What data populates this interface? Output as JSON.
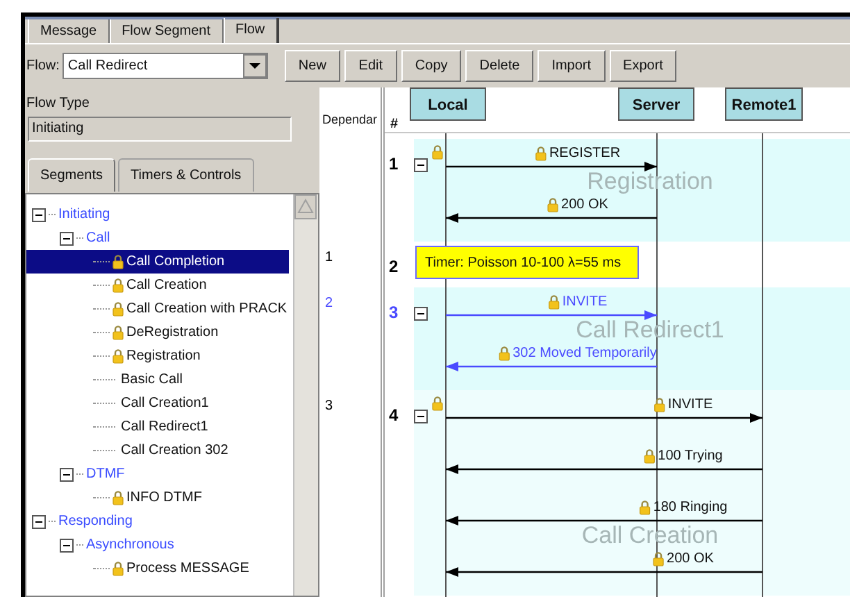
{
  "tabs": [
    {
      "label": "Message",
      "selected": false
    },
    {
      "label": "Flow Segment",
      "selected": false
    },
    {
      "label": "Flow",
      "selected": true
    }
  ],
  "flow": {
    "label": "Flow:",
    "value": "Call Redirect"
  },
  "toolbar": [
    "New",
    "Edit",
    "Copy",
    "Delete",
    "Import",
    "Export"
  ],
  "flow_type": {
    "label": "Flow Type",
    "value": "Initiating"
  },
  "panel_tabs": [
    {
      "label": "Segments",
      "selected": true
    },
    {
      "label": "Timers & Controls",
      "selected": false
    }
  ],
  "tree": [
    {
      "label": "Initiating",
      "kind": "folder",
      "expanded": true,
      "selected": false,
      "children": [
        {
          "label": "Call",
          "kind": "folder",
          "expanded": true,
          "selected": false,
          "children": [
            {
              "label": "Call Completion",
              "kind": "item",
              "locked": true,
              "selected": true
            },
            {
              "label": "Call Creation",
              "kind": "item",
              "locked": true,
              "selected": false
            },
            {
              "label": "Call Creation with PRACK",
              "kind": "item",
              "locked": true,
              "selected": false
            },
            {
              "label": "DeRegistration",
              "kind": "item",
              "locked": true,
              "selected": false
            },
            {
              "label": "Registration",
              "kind": "item",
              "locked": true,
              "selected": false
            },
            {
              "label": "Basic Call",
              "kind": "item",
              "locked": false,
              "selected": false
            },
            {
              "label": "Call Creation1",
              "kind": "item",
              "locked": false,
              "selected": false
            },
            {
              "label": "Call Redirect1",
              "kind": "item",
              "locked": false,
              "selected": false
            },
            {
              "label": "Call Creation 302",
              "kind": "item",
              "locked": false,
              "selected": false
            }
          ]
        },
        {
          "label": "DTMF",
          "kind": "folder",
          "expanded": true,
          "selected": false,
          "children": [
            {
              "label": "INFO DTMF",
              "kind": "item",
              "locked": true,
              "selected": false
            }
          ]
        }
      ]
    },
    {
      "label": "Responding",
      "kind": "folder",
      "expanded": true,
      "selected": false,
      "children": [
        {
          "label": "Asynchronous",
          "kind": "folder",
          "expanded": true,
          "selected": false,
          "children": [
            {
              "label": "Process MESSAGE",
              "kind": "item",
              "locked": true,
              "selected": false
            }
          ]
        }
      ]
    }
  ],
  "diagram": {
    "dependency_header": "Dependar",
    "number_header": "#",
    "participants": [
      "Local",
      "Server",
      "Remote1"
    ],
    "segments": [
      {
        "kind": "flow",
        "number": "1",
        "expanded": true,
        "locked": true,
        "color": "#000000",
        "watermark": "Registration",
        "messages": [
          {
            "label": "REGISTER",
            "kind": "toserver",
            "locked": true
          },
          {
            "label": "200 OK",
            "kind": "fromserver",
            "locked": true
          }
        ]
      },
      {
        "kind": "timer",
        "number": "2",
        "dependency": "1",
        "color": "#000000",
        "text": "Timer: Poisson 10-100 λ=55 ms"
      },
      {
        "kind": "flow",
        "number": "3",
        "dependency": "2",
        "expanded": true,
        "locked": false,
        "color": "#4a4aff",
        "watermark": "Call Redirect1",
        "messages": [
          {
            "label": "INVITE",
            "kind": "toserver",
            "locked": true
          },
          {
            "label": "302 Moved Temporarily",
            "kind": "fromserver",
            "locked": true
          }
        ]
      },
      {
        "kind": "flow",
        "number": "4",
        "dependency": "3",
        "expanded": true,
        "locked": true,
        "color": "#000000",
        "watermark": "Call Creation",
        "messages": [
          {
            "label": "INVITE",
            "kind": "toremote",
            "locked": true
          },
          {
            "label": "100 Trying",
            "kind": "fromremote",
            "locked": true
          },
          {
            "label": "180 Ringing",
            "kind": "fromremote",
            "locked": true
          },
          {
            "label": "200 OK",
            "kind": "fromremote",
            "locked": true
          }
        ]
      }
    ]
  }
}
